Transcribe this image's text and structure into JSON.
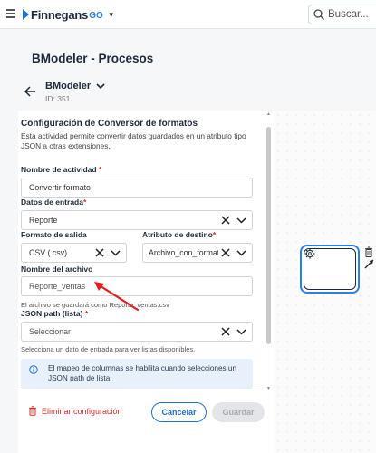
{
  "topbar": {
    "logo_text": "Finnegans",
    "logo_suffix": "GO",
    "search_placeholder": "Buscar..."
  },
  "page": {
    "title": "BModeler - Procesos"
  },
  "process": {
    "name": "BModeler",
    "id": "ID: 351"
  },
  "config": {
    "title": "Configuración de Conversor de formatos",
    "description": "Esta actividad permite convertir datos guardados en un atributo tipo JSON a otras extensiones.",
    "activity_name_label": "Nombre de actividad",
    "activity_name_value": "Convertir formato",
    "input_data_label": "Datos de entrada",
    "input_data_value": "Reporte",
    "output_format_label": "Formato de salida",
    "output_format_value": "CSV (.csv)",
    "target_attr_label": "Atributo de destino",
    "target_attr_value": "Archivo_con_formato",
    "file_name_label": "Nombre del archivo",
    "file_name_value": "Reporte_ventas",
    "file_hint": "El archivo se guardará como Reporte_ventas.csv",
    "json_path_label": "JSON path (lista)",
    "json_path_placeholder": "Seleccionar",
    "json_path_hint": "Selecciona un dato de entrada para ver listas disponibles.",
    "info_text": "El mapeo de columnas se habilita cuando selecciones un JSON path de lista.",
    "required_mark": "*"
  },
  "footer": {
    "delete_label": "Eliminar configuración",
    "cancel_label": "Cancelar",
    "save_label": "Guardar"
  },
  "colors": {
    "accent": "#1a6fd0",
    "danger": "#d32f2f",
    "annotation": "#e02020"
  },
  "icons": {
    "menu": "hamburger-icon",
    "search": "search-icon",
    "back": "arrow-left-icon",
    "clear": "close-icon",
    "dropdown": "chevron-down-icon",
    "info": "info-icon",
    "delete": "trash-icon",
    "task": "gear-icon",
    "connect": "arrow-icon"
  }
}
